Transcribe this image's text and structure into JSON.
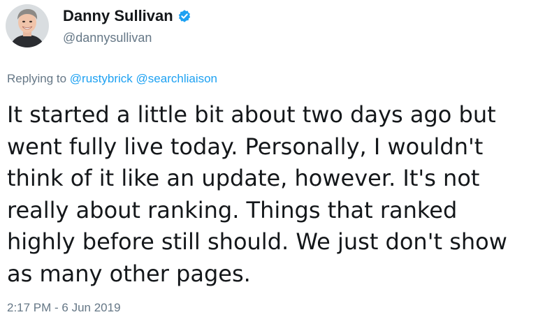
{
  "author": {
    "display_name": "Danny Sullivan",
    "handle": "@dannysullivan",
    "verified": true,
    "avatar_icon": "profile-photo"
  },
  "reply": {
    "prefix": "Replying to",
    "mentions": [
      "@rustybrick",
      "@searchliaison"
    ]
  },
  "tweet": {
    "lines": [
      "It started a little bit about two days ago but",
      "went fully live today. Personally, I wouldn't",
      "think of it like an update, however. It's not",
      "really about ranking. Things that ranked",
      "highly before still should. We just don't show",
      "as many other pages."
    ]
  },
  "timestamp": "2:17 PM - 6 Jun 2019",
  "colors": {
    "link": "#1da1f2",
    "muted": "#657786",
    "text": "#14171a",
    "verified_badge": "#1da1f2"
  }
}
